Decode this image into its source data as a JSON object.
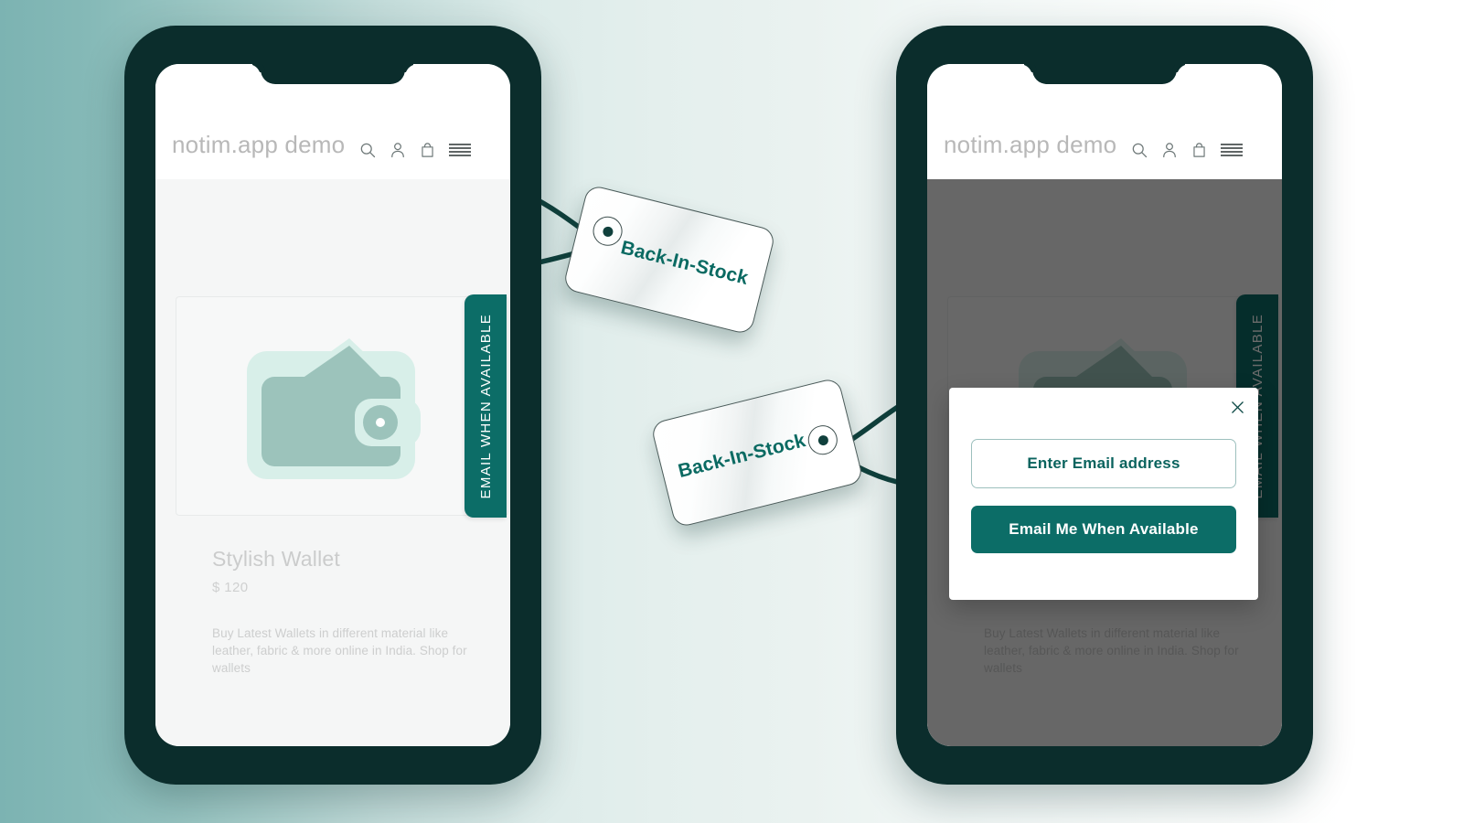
{
  "background": {
    "gradient_from": "#7cb3b2",
    "gradient_to": "#ffffff"
  },
  "theme": {
    "accent_teal": "#0c6d67",
    "accent_teal_dark": "#0a635e",
    "phone_frame": "#0b2d2c",
    "muted_text": "#cbcccc"
  },
  "storefront": {
    "brand": "notim.app demo",
    "icons": [
      "search-icon",
      "account-icon",
      "bag-icon",
      "menu-icon"
    ],
    "product": {
      "title": "Stylish Wallet",
      "price": "$ 120",
      "description": "Buy Latest Wallets in different material like leather, fabric & more online in India. Shop for wallets",
      "image_alt": "wallet-illustration"
    },
    "email_tab_label": "EMAIL WHEN AVAILABLE"
  },
  "modal": {
    "close_label": "×",
    "email_placeholder": "Enter Email address",
    "email_value": "",
    "submit_label": "Email Me When Available"
  },
  "tags": [
    {
      "label": "Back-In-Stock"
    },
    {
      "label": "Back-In-Stock"
    }
  ]
}
